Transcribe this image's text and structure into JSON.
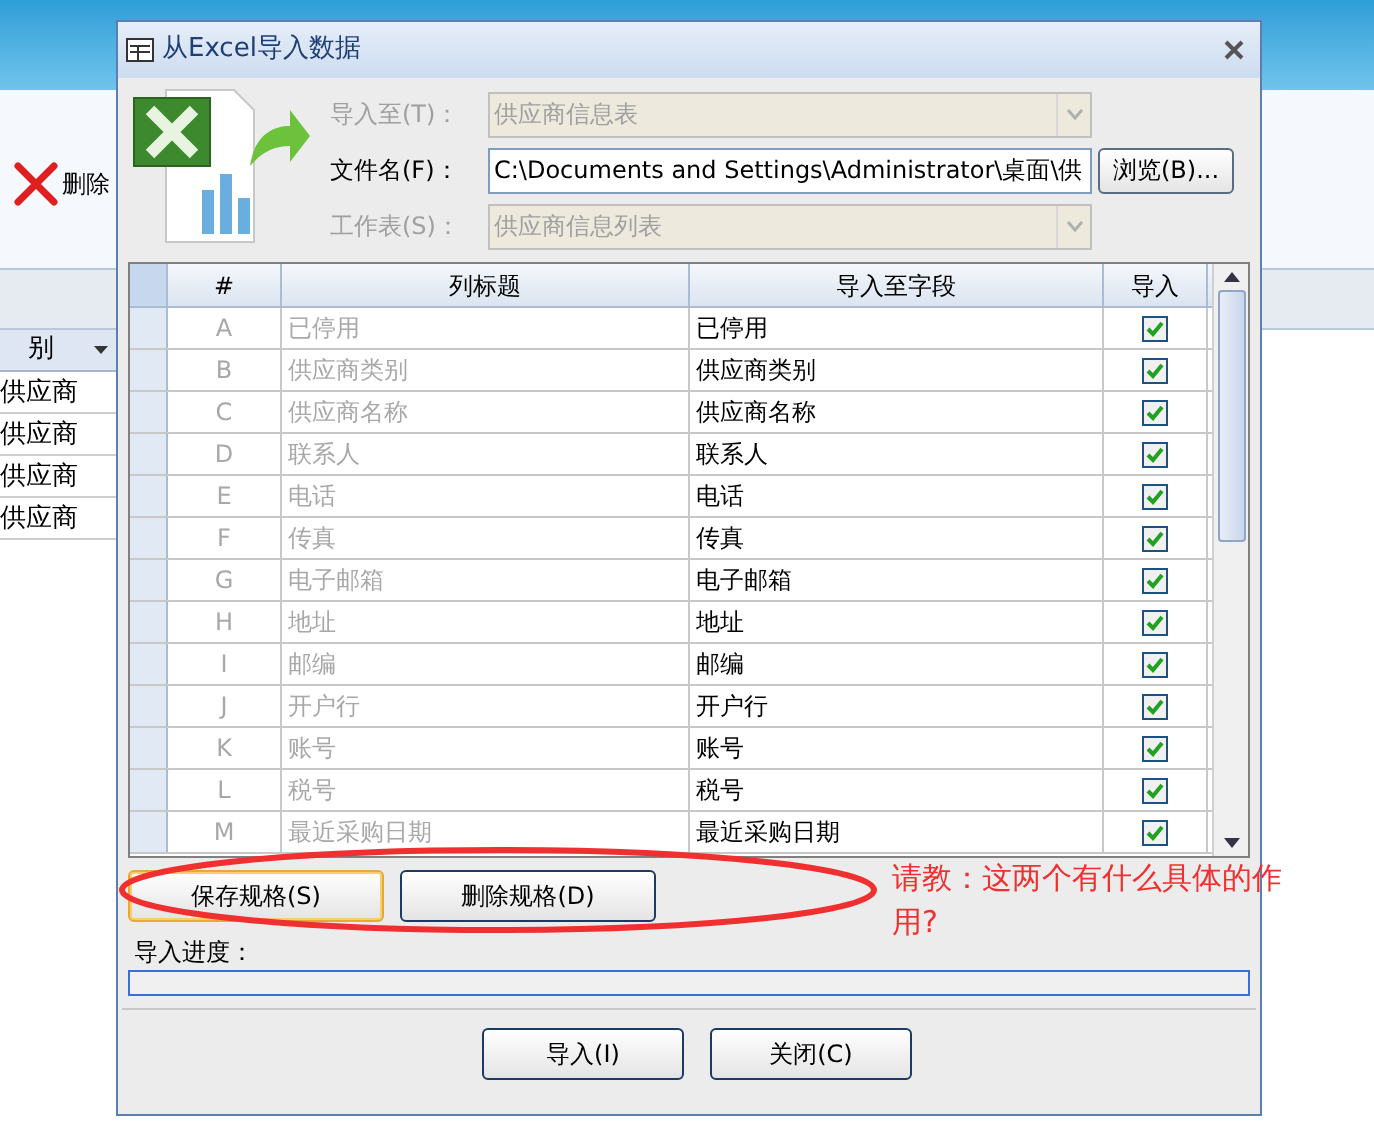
{
  "background": {
    "delete_label": "删除",
    "column_header": "别",
    "rows": [
      "供应商",
      "供应商",
      "供应商",
      "供应商"
    ]
  },
  "dialog": {
    "title": "从Excel导入数据",
    "fields": [
      {
        "label": "导入至(T)：",
        "value": "供应商信息表",
        "disabled": true,
        "kind": "combo"
      },
      {
        "label": "文件名(F)：",
        "value": "C:\\Documents and Settings\\Administrator\\桌面\\供",
        "disabled": false,
        "kind": "text"
      },
      {
        "label": "工作表(S)：",
        "value": "供应商信息列表",
        "disabled": true,
        "kind": "combo"
      }
    ],
    "browse_button": "浏览(B)...",
    "table": {
      "columns": [
        "#",
        "列标题",
        "导入至字段",
        "导入"
      ],
      "rows": [
        {
          "letter": "A",
          "title": "已停用",
          "field": "已停用",
          "checked": true
        },
        {
          "letter": "B",
          "title": "供应商类别",
          "field": "供应商类别",
          "checked": true
        },
        {
          "letter": "C",
          "title": "供应商名称",
          "field": "供应商名称",
          "checked": true
        },
        {
          "letter": "D",
          "title": "联系人",
          "field": "联系人",
          "checked": true
        },
        {
          "letter": "E",
          "title": "电话",
          "field": "电话",
          "checked": true
        },
        {
          "letter": "F",
          "title": "传真",
          "field": "传真",
          "checked": true
        },
        {
          "letter": "G",
          "title": "电子邮箱",
          "field": "电子邮箱",
          "checked": true
        },
        {
          "letter": "H",
          "title": "地址",
          "field": "地址",
          "checked": true
        },
        {
          "letter": "I",
          "title": "邮编",
          "field": "邮编",
          "checked": true
        },
        {
          "letter": "J",
          "title": "开户行",
          "field": "开户行",
          "checked": true
        },
        {
          "letter": "K",
          "title": "账号",
          "field": "账号",
          "checked": true
        },
        {
          "letter": "L",
          "title": "税号",
          "field": "税号",
          "checked": true
        },
        {
          "letter": "M",
          "title": "最近采购日期",
          "field": "最近采购日期",
          "checked": true
        }
      ]
    },
    "spec_buttons": [
      {
        "label": "保存规格(S)",
        "selected": true
      },
      {
        "label": "删除规格(D)",
        "selected": false
      }
    ],
    "progress_label": "导入进度：",
    "progress": {
      "level": 0
    },
    "footer_buttons": [
      "导入(I)",
      "关闭(C)"
    ]
  },
  "annotation": "请教：这两个有什么具体的作用?"
}
